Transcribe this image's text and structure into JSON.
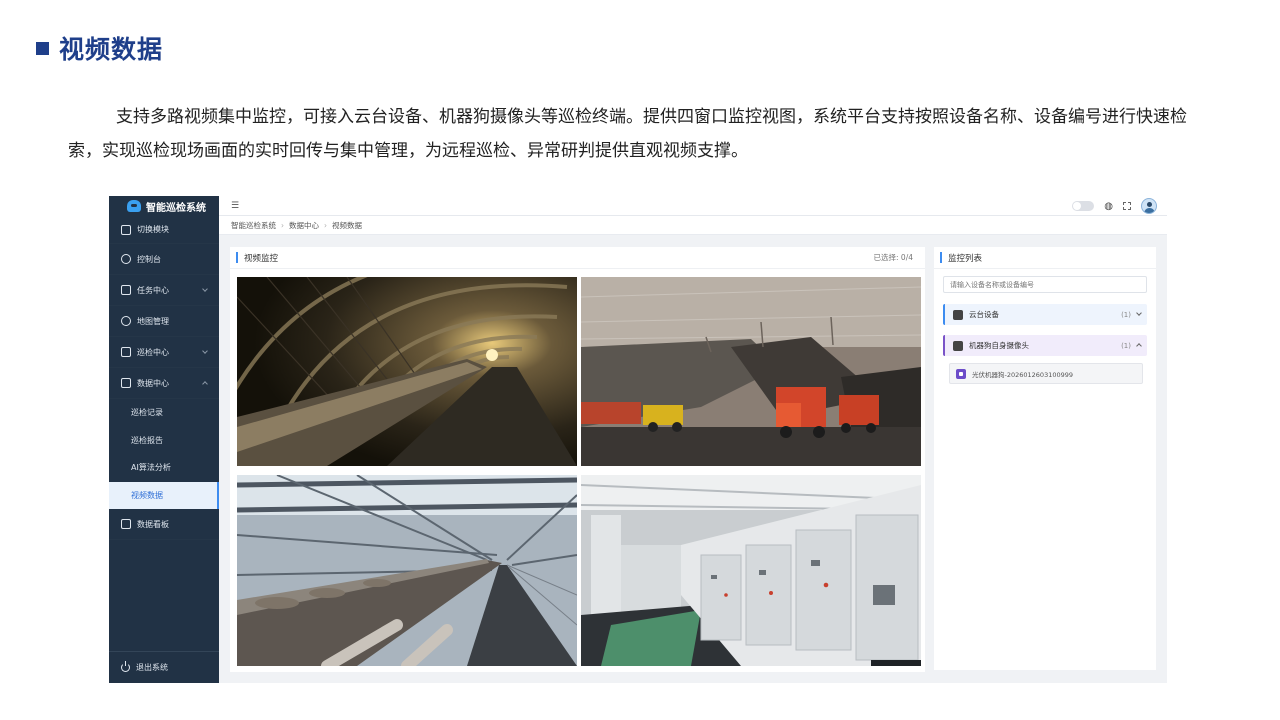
{
  "slide": {
    "title": "视频数据",
    "description": "支持多路视频集中监控，可接入云台设备、机器狗摄像头等巡检终端。提供四窗口监控视图，系统平台支持按照设备名称、设备编号进行快速检索，实现巡检现场画面的实时回传与集中管理，为远程巡检、异常研判提供直观视频支撑。",
    "accent_color": "#1f3f8a"
  },
  "app": {
    "brand": "智能巡检系统",
    "sidebar": {
      "items": [
        {
          "label": "切换模块",
          "icon": "grid-icon"
        },
        {
          "label": "控制台",
          "icon": "dashboard-icon"
        },
        {
          "label": "任务中心",
          "icon": "calendar-icon"
        },
        {
          "label": "地图管理",
          "icon": "map-user-icon"
        },
        {
          "label": "巡检中心",
          "icon": "clipboard-icon"
        },
        {
          "label": "数据中心",
          "icon": "data-icon"
        }
      ],
      "sub_items": [
        {
          "label": "巡检记录"
        },
        {
          "label": "巡检报告"
        },
        {
          "label": "AI算法分析"
        },
        {
          "label": "视频数据",
          "active": true
        }
      ],
      "dashboard": {
        "label": "数据看板",
        "icon": "monitor-icon"
      },
      "logout": "退出系统"
    },
    "topbar": {
      "menu_icon": "menu-icon"
    },
    "breadcrumb": [
      "智能巡检系统",
      "数据中心",
      "视频数据"
    ],
    "video_panel": {
      "title": "视频监控",
      "selected": "已选择: 0/4"
    },
    "list_panel": {
      "title": "监控列表",
      "search_placeholder": "请输入设备名称或设备编号",
      "groups": [
        {
          "label": "云台设备",
          "count": "(1)",
          "icon": "ptz-camera-icon",
          "expanded": false
        },
        {
          "label": "机器狗自身摄像头",
          "count": "(1)",
          "icon": "robot-dog-icon",
          "expanded": true
        }
      ],
      "device": "光伏机器狗-2026012603100999"
    }
  }
}
